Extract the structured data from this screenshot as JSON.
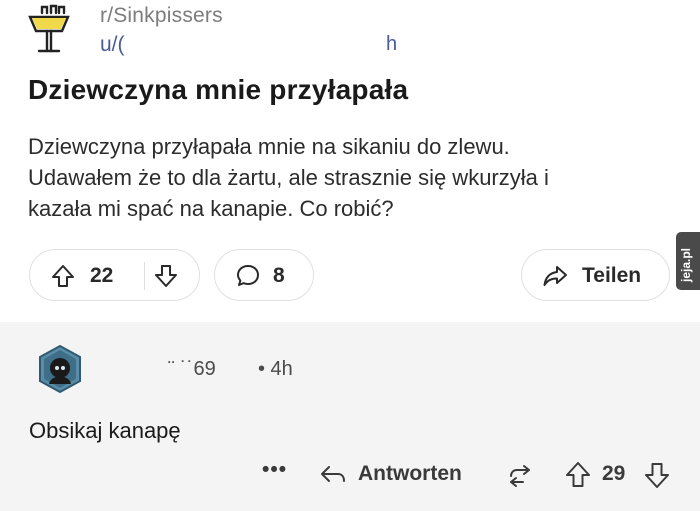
{
  "post": {
    "subreddit": "r/Sinkpissers",
    "username": "u/(",
    "username_tail": "h",
    "title": "Dziewczyna mnie przyłapała",
    "body_lines": [
      "Dziewczyna przyłapała mnie na sikaniu do zlewu.",
      "Udawałem że to dla żartu, ale strasznie się wkurzyła i",
      "kazała mi spać na kanapie. Co robić?"
    ],
    "upvotes": "22",
    "comments": "8",
    "share_label": "Teilen",
    "icons": [
      "sink-logo-icon",
      "upvote-icon",
      "downvote-icon",
      "comment-bubble-icon",
      "share-arrow-icon"
    ]
  },
  "comment": {
    "author": "¨ ˙˙69",
    "time": "• 4h",
    "text": "Obsikaj kanapę",
    "more_label": "•••",
    "reply_label": "Antworten",
    "votes": "29"
  },
  "watermark": "jeja.pl",
  "colors": {
    "background": "#f4f4f4",
    "card": "#ffffff",
    "username": "#4a5a9a",
    "meta": "#7c7c7c"
  }
}
